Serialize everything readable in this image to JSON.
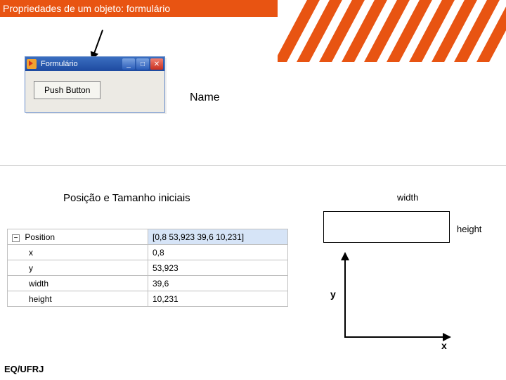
{
  "header": {
    "title": "Propriedades de um objeto: formulário"
  },
  "window": {
    "title": "Formulário",
    "button_label": "Push Button"
  },
  "labels": {
    "name": "Name",
    "section": "Posição e Tamanho iniciais",
    "width": "width",
    "height": "height",
    "x_axis": "x",
    "y_axis": "y"
  },
  "properties": {
    "root": {
      "key": "Position",
      "value": "[0,8 53,923 39,6 10,231]"
    },
    "rows": [
      {
        "key": "x",
        "value": "0,8"
      },
      {
        "key": "y",
        "value": "53,923"
      },
      {
        "key": "width",
        "value": "39,6"
      },
      {
        "key": "height",
        "value": "10,231"
      }
    ]
  },
  "footer": "EQ/UFRJ"
}
